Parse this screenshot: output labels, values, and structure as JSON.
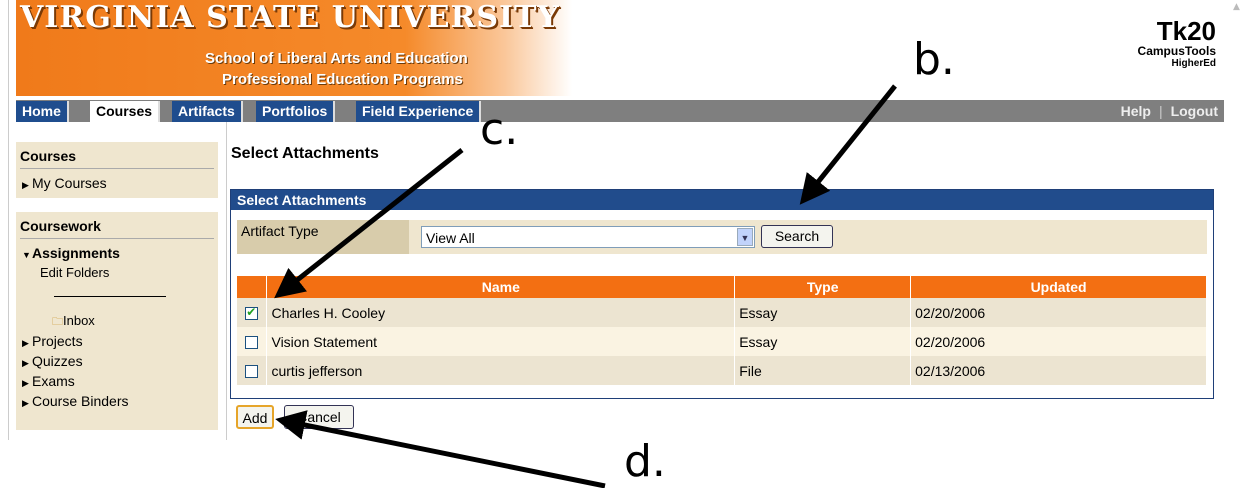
{
  "header": {
    "university": "VIRGINIA STATE UNIVERSITY",
    "school": "School of Liberal Arts and Education",
    "program": "Professional Education Programs",
    "logo_main": "Tk20",
    "logo_sub1": "CampusTools",
    "logo_sub2": "HigherEd"
  },
  "nav": {
    "tabs": [
      {
        "label": "Home"
      },
      {
        "label": "Courses",
        "active": true
      },
      {
        "label": "Artifacts"
      },
      {
        "label": "Portfolios"
      },
      {
        "label": "Field Experience"
      }
    ],
    "help": "Help",
    "logout": "Logout"
  },
  "sidebar": {
    "courses_head": "Courses",
    "my_courses": "My Courses",
    "coursework_head": "Coursework",
    "assignments": "Assignments",
    "edit_folders": "Edit Folders",
    "inbox": "Inbox",
    "projects": "Projects",
    "quizzes": "Quizzes",
    "exams": "Exams",
    "course_binders": "Course Binders"
  },
  "main": {
    "page_title": "Select Attachments",
    "panel_title": "Select Attachments",
    "filter_label": "Artifact Type",
    "filter_value": "View All",
    "search_label": "Search",
    "columns": [
      "Name",
      "Type",
      "Updated"
    ],
    "rows": [
      {
        "name": "Charles H. Cooley",
        "type": "Essay",
        "updated": "02/20/2006",
        "checked": true
      },
      {
        "name": "Vision Statement",
        "type": "Essay",
        "updated": "02/20/2006",
        "checked": false
      },
      {
        "name": "curtis jefferson",
        "type": "File",
        "updated": "02/13/2006",
        "checked": false
      }
    ],
    "add_label": "Add",
    "cancel_label": "Cancel"
  },
  "annotations": {
    "b": "b.",
    "c": "c.",
    "d": "d."
  },
  "colors": {
    "banner_orange": "#f07a1a",
    "nav_blue": "#1f4d8e",
    "grid_header_orange": "#f36f12",
    "sidebar_beige": "#efe6cf"
  }
}
